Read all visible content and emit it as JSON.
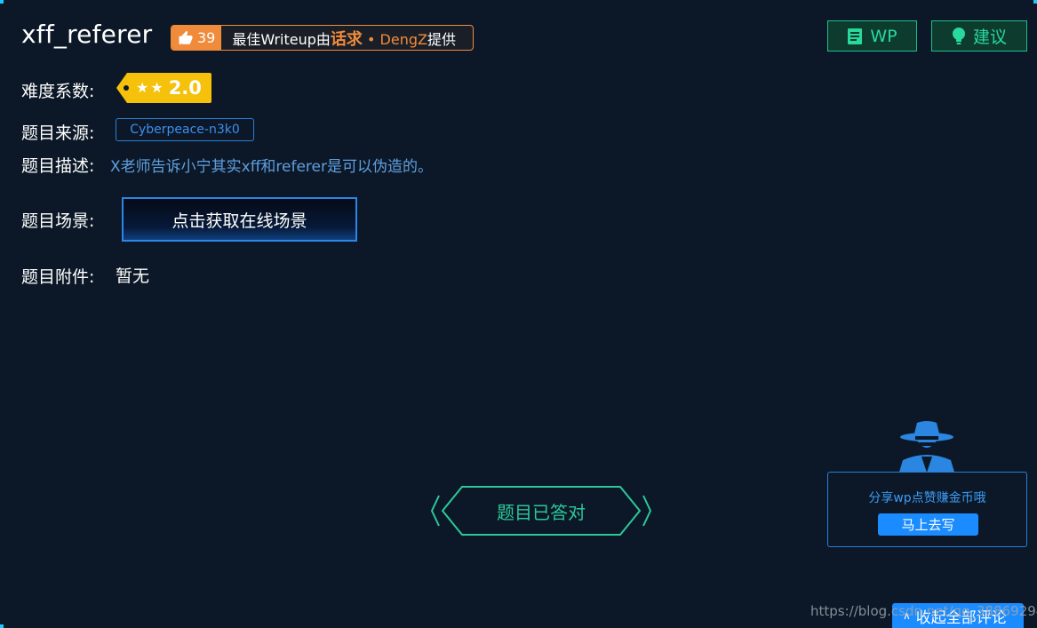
{
  "challenge": {
    "title": "xff_referer",
    "likes": "39",
    "wp_prefix": "最佳Writeup由",
    "wp_team": "话求",
    "wp_sep": "•",
    "wp_author": "DengZ",
    "wp_suffix": "提供"
  },
  "top_buttons": {
    "wp_label": "WP",
    "suggest_label": "建议"
  },
  "fields": {
    "difficulty_label": "难度系数:",
    "difficulty_score": "2.0",
    "difficulty_stars": 2,
    "source_label": "题目来源:",
    "source_value": "Cyberpeace-n3k0",
    "desc_label": "题目描述:",
    "desc_value": "X老师告诉小宁其实xff和referer是可以伪造的。",
    "scene_label": "题目场景:",
    "scene_button": "点击获取在线场景",
    "attach_label": "题目附件:",
    "attach_value": "暂无"
  },
  "status": {
    "solved_label": "题目已答对"
  },
  "share": {
    "text": "分享wp点赞赚金币哦",
    "button": "马上去写"
  },
  "footer": {
    "collapse_label": "收起全部评论",
    "watermark": "https://blog.csdn.net/qq_38869294"
  },
  "colors": {
    "background": "#0c1827",
    "accent_orange": "#f08b3c",
    "accent_green": "#29d99c",
    "accent_blue": "#1a8cff",
    "star_yellow": "#f5c10b"
  }
}
